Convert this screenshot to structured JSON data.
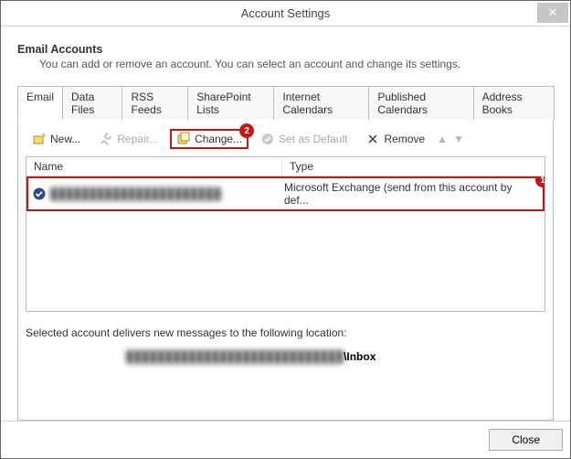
{
  "titlebar": {
    "title": "Account Settings"
  },
  "header": {
    "title": "Email Accounts",
    "subtitle": "You can add or remove an account. You can select an account and change its settings."
  },
  "tabs": [
    {
      "label": "Email",
      "active": true
    },
    {
      "label": "Data Files"
    },
    {
      "label": "RSS Feeds"
    },
    {
      "label": "SharePoint Lists"
    },
    {
      "label": "Internet Calendars"
    },
    {
      "label": "Published Calendars"
    },
    {
      "label": "Address Books"
    }
  ],
  "toolbar": {
    "new": "New...",
    "repair": "Repair...",
    "change": "Change...",
    "set_default": "Set as Default",
    "remove": "Remove"
  },
  "markers": {
    "row": "1",
    "change": "2"
  },
  "table": {
    "columns": {
      "name": "Name",
      "type": "Type"
    },
    "rows": [
      {
        "name": "██████████████████████",
        "type": "Microsoft Exchange (send from this account by def..."
      }
    ]
  },
  "location": {
    "label": "Selected account delivers new messages to the following location:",
    "path_prefix": "████████████████████████████",
    "path_suffix": "\\Inbox"
  },
  "footer": {
    "close": "Close"
  }
}
